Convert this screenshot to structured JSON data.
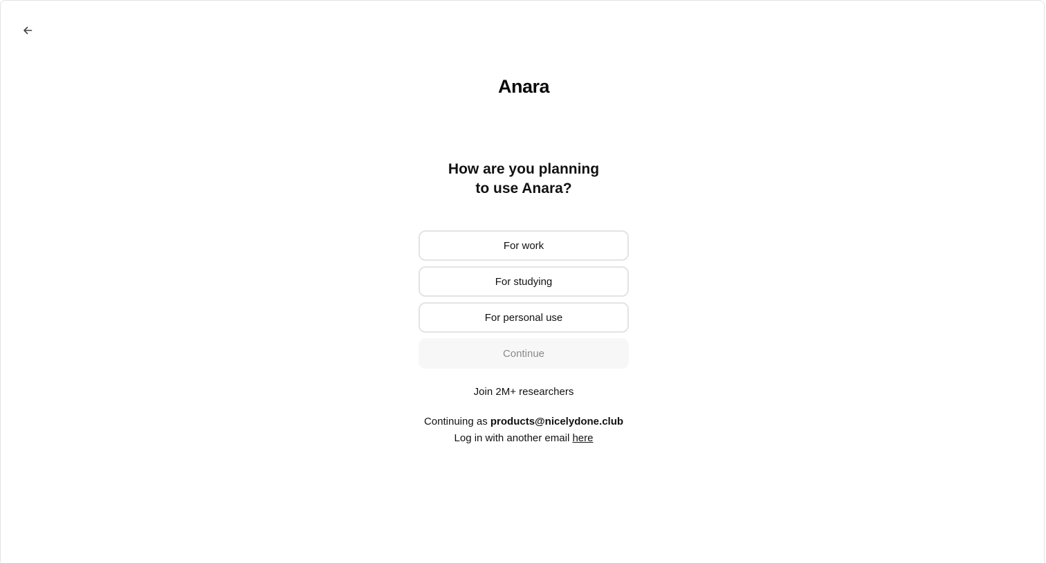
{
  "app": {
    "logo_text": "Anara"
  },
  "nav": {
    "back_icon": "arrow-left-icon"
  },
  "question": {
    "line1": "How are you planning",
    "line2": "to use Anara?"
  },
  "options": [
    {
      "label": "For work"
    },
    {
      "label": "For studying"
    },
    {
      "label": "For personal use"
    }
  ],
  "continue_button": {
    "label": "Continue",
    "state": "disabled"
  },
  "social_proof": {
    "text": "Join 2M+ researchers"
  },
  "account": {
    "prefix": "Continuing as",
    "email": "products@nicelydone.club",
    "switch_text": "Log in with another email",
    "switch_link": "here"
  },
  "colors": {
    "option_border": "#e3e3e3",
    "continue_bg": "#f7f7f7",
    "continue_text": "#8a8a8a"
  }
}
